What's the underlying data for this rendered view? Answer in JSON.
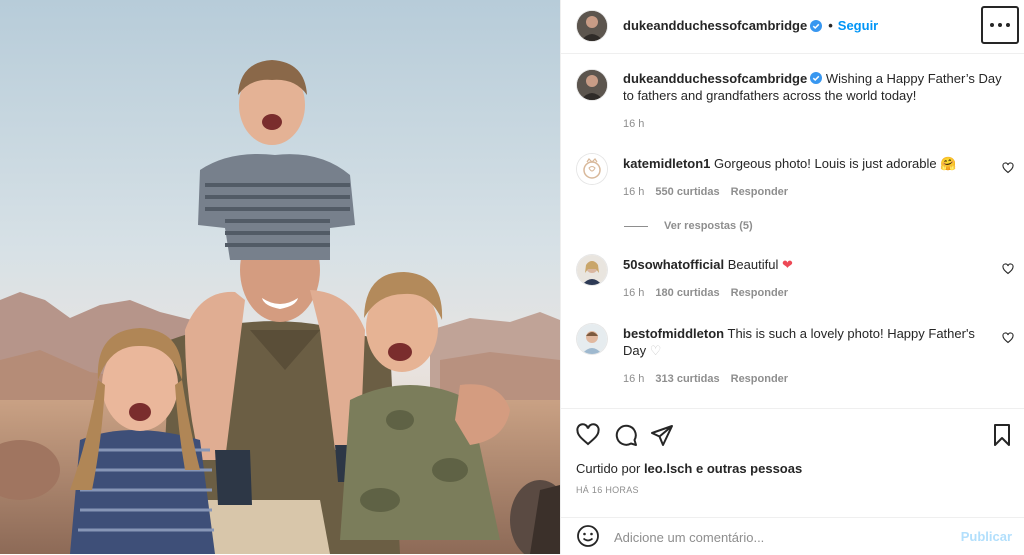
{
  "post": {
    "author": "dukeandduchessofcambridge",
    "follow_label": "Seguir",
    "separator": "•",
    "caption": "Wishing a Happy Father’s Day to fathers and grandfathers across the world today!",
    "caption_time": "16 h"
  },
  "comments": [
    {
      "user": "katemidleton1",
      "text": "Gorgeous photo! Louis is just adorable",
      "emoji": "🤗",
      "time": "16 h",
      "likes": "550 curtidas",
      "reply": "Responder"
    },
    {
      "user": "50sowhatofficial",
      "text": "Beautiful",
      "emoji": "❤",
      "time": "16 h",
      "likes": "180 curtidas",
      "reply": "Responder"
    },
    {
      "user": "bestofmiddleton",
      "text": "This is such a lovely photo! Happy Father's Day",
      "emoji": "♡",
      "time": "16 h",
      "likes": "313 curtidas",
      "reply": "Responder"
    }
  ],
  "view_replies": "Ver respostas (5)",
  "actions": {
    "liked_by_prefix": "Curtido por",
    "liked_by_user": "leo.lsch",
    "liked_by_suffix": "e outras pessoas",
    "time_ago": "HÁ 16 HORAS"
  },
  "add_comment": {
    "placeholder": "Adicione um comentário...",
    "post_label": "Publicar"
  },
  "icons": [
    "verified-badge-icon",
    "more-options-icon",
    "heart-icon",
    "comment-icon",
    "share-icon",
    "bookmark-icon",
    "emoji-icon"
  ],
  "colors": {
    "accent": "#0095f6",
    "verified": "#3897f0",
    "red_heart": "#ed4956",
    "muted": "#8e8e8e"
  }
}
